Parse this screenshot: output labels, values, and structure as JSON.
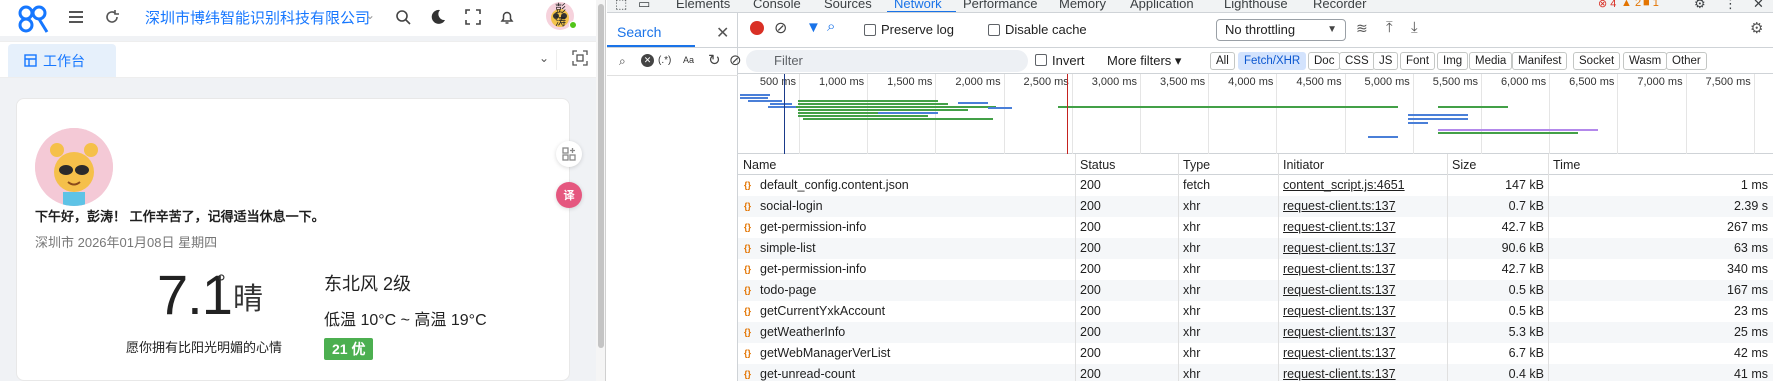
{
  "app": {
    "company": "深圳市博纬智能识别科技有限公司",
    "user_name": "彭涛",
    "tab_label": "工作台",
    "greeting": "下午好，彭涛！ 工作辛苦了，记得适当休息一下。",
    "date": "深圳市 2026年01月08日 星期四",
    "weather": {
      "temperature": "7.1",
      "degree": "°",
      "condition": "晴",
      "wind": "东北风 2级",
      "range": "低温 10°C ~ 高温 19°C",
      "aqi": "21 优",
      "motto": "愿你拥有比阳光明媚的心情"
    },
    "colors": {
      "accent": "#1677ff",
      "aqi_good": "#4caf50"
    }
  },
  "devtools": {
    "tabs": [
      "Elements",
      "Console",
      "Sources",
      "Network",
      "Performance",
      "Memory",
      "Application",
      "Lighthouse",
      "Recorder"
    ],
    "active_tab": "Network",
    "counts": {
      "errors": "4",
      "warnings": "2",
      "issues": "1"
    },
    "search": {
      "title": "Search",
      "regex_label": "(.*)",
      "case_label": "Aa"
    },
    "toolbar": {
      "preserve_log": "Preserve log",
      "disable_cache": "Disable cache",
      "throttling": "No throttling"
    },
    "filter": {
      "placeholder": "Filter",
      "invert": "Invert",
      "more_filters": "More filters",
      "types": [
        "All",
        "Fetch/XHR",
        "Doc",
        "CSS",
        "JS",
        "Font",
        "Img",
        "Media",
        "Manifest",
        "Socket",
        "Wasm",
        "Other"
      ],
      "active_type": "Fetch/XHR"
    },
    "timeline": {
      "ticks": [
        "500 ms",
        "1,000 ms",
        "1,500 ms",
        "2,000 ms",
        "2,500 ms",
        "3,000 ms",
        "3,500 ms",
        "4,000 ms",
        "4,500 ms",
        "5,000 ms",
        "5,500 ms",
        "6,000 ms",
        "6,500 ms",
        "7,000 ms",
        "7,500 ms"
      ]
    },
    "table": {
      "columns": [
        "Name",
        "Status",
        "Type",
        "Initiator",
        "Size",
        "Time"
      ],
      "rows": [
        {
          "name": "default_config.content.json",
          "status": "200",
          "type": "fetch",
          "initiator": "content_script.js:4651",
          "size": "147 kB",
          "time": "1 ms"
        },
        {
          "name": "social-login",
          "status": "200",
          "type": "xhr",
          "initiator": "request-client.ts:137",
          "size": "0.7 kB",
          "time": "2.39 s"
        },
        {
          "name": "get-permission-info",
          "status": "200",
          "type": "xhr",
          "initiator": "request-client.ts:137",
          "size": "42.7 kB",
          "time": "267 ms"
        },
        {
          "name": "simple-list",
          "status": "200",
          "type": "xhr",
          "initiator": "request-client.ts:137",
          "size": "90.6 kB",
          "time": "63 ms"
        },
        {
          "name": "get-permission-info",
          "status": "200",
          "type": "xhr",
          "initiator": "request-client.ts:137",
          "size": "42.7 kB",
          "time": "340 ms"
        },
        {
          "name": "todo-page",
          "status": "200",
          "type": "xhr",
          "initiator": "request-client.ts:137",
          "size": "0.5 kB",
          "time": "167 ms"
        },
        {
          "name": "getCurrentYxkAccount",
          "status": "200",
          "type": "xhr",
          "initiator": "request-client.ts:137",
          "size": "0.5 kB",
          "time": "23 ms"
        },
        {
          "name": "getWeatherInfo",
          "status": "200",
          "type": "xhr",
          "initiator": "request-client.ts:137",
          "size": "5.3 kB",
          "time": "25 ms"
        },
        {
          "name": "getWebManagerVerList",
          "status": "200",
          "type": "xhr",
          "initiator": "request-client.ts:137",
          "size": "6.7 kB",
          "time": "42 ms"
        },
        {
          "name": "get-unread-count",
          "status": "200",
          "type": "xhr",
          "initiator": "request-client.ts:137",
          "size": "0.4 kB",
          "time": "41 ms"
        }
      ]
    }
  }
}
